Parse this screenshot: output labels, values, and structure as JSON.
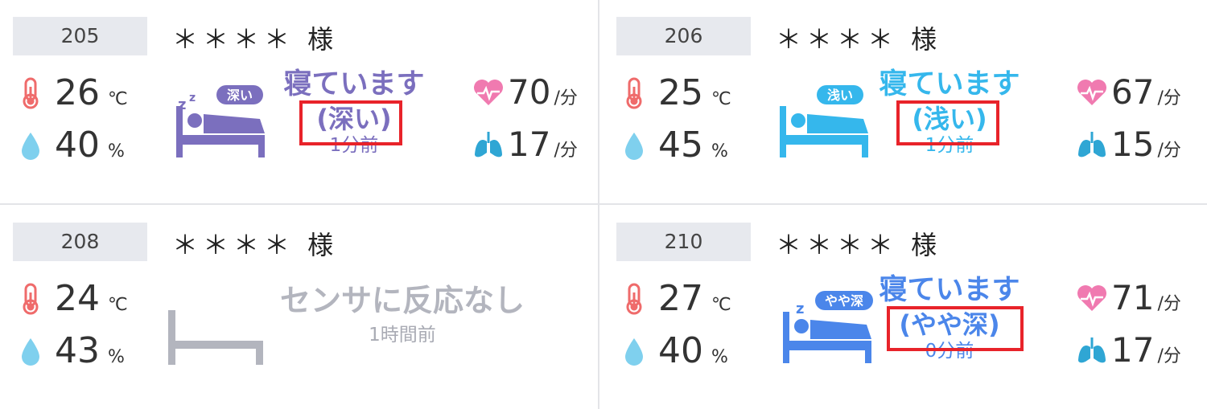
{
  "colors": {
    "deep": "#7b6fbe",
    "light": "#35b7ec",
    "medium_deep": "#4b86ea",
    "no_sensor": "#b3b5be",
    "temp_icon": "#ef6b6b",
    "humidity_icon": "#7fd0ee",
    "heart_icon": "#f07ab0",
    "lung_icon": "#2fa6d4",
    "highlight_box": "#e8232a"
  },
  "cards": [
    {
      "room": "205",
      "resident": "＊＊＊＊ 様",
      "temperature": "26",
      "temp_unit": "℃",
      "humidity": "40",
      "humidity_unit": "%",
      "badge": "深い",
      "status": "寝ています",
      "depth": "(深い)",
      "time": "1分前",
      "heart_rate": "70",
      "heart_unit": "/分",
      "resp_rate": "17",
      "resp_unit": "/分"
    },
    {
      "room": "206",
      "resident": "＊＊＊＊ 様",
      "temperature": "25",
      "temp_unit": "℃",
      "humidity": "45",
      "humidity_unit": "%",
      "badge": "浅い",
      "status": "寝ています",
      "depth": "(浅い)",
      "time": "1分前",
      "heart_rate": "67",
      "heart_unit": "/分",
      "resp_rate": "15",
      "resp_unit": "/分"
    },
    {
      "room": "208",
      "resident": "＊＊＊＊ 様",
      "temperature": "24",
      "temp_unit": "℃",
      "humidity": "43",
      "humidity_unit": "%",
      "status": "センサに反応なし",
      "time": "1時間前"
    },
    {
      "room": "210",
      "resident": "＊＊＊＊ 様",
      "temperature": "27",
      "temp_unit": "℃",
      "humidity": "40",
      "humidity_unit": "%",
      "badge": "やや深",
      "status": "寝ています",
      "depth": "(やや深)",
      "time": "0分前",
      "heart_rate": "71",
      "heart_unit": "/分",
      "resp_rate": "17",
      "resp_unit": "/分"
    }
  ]
}
